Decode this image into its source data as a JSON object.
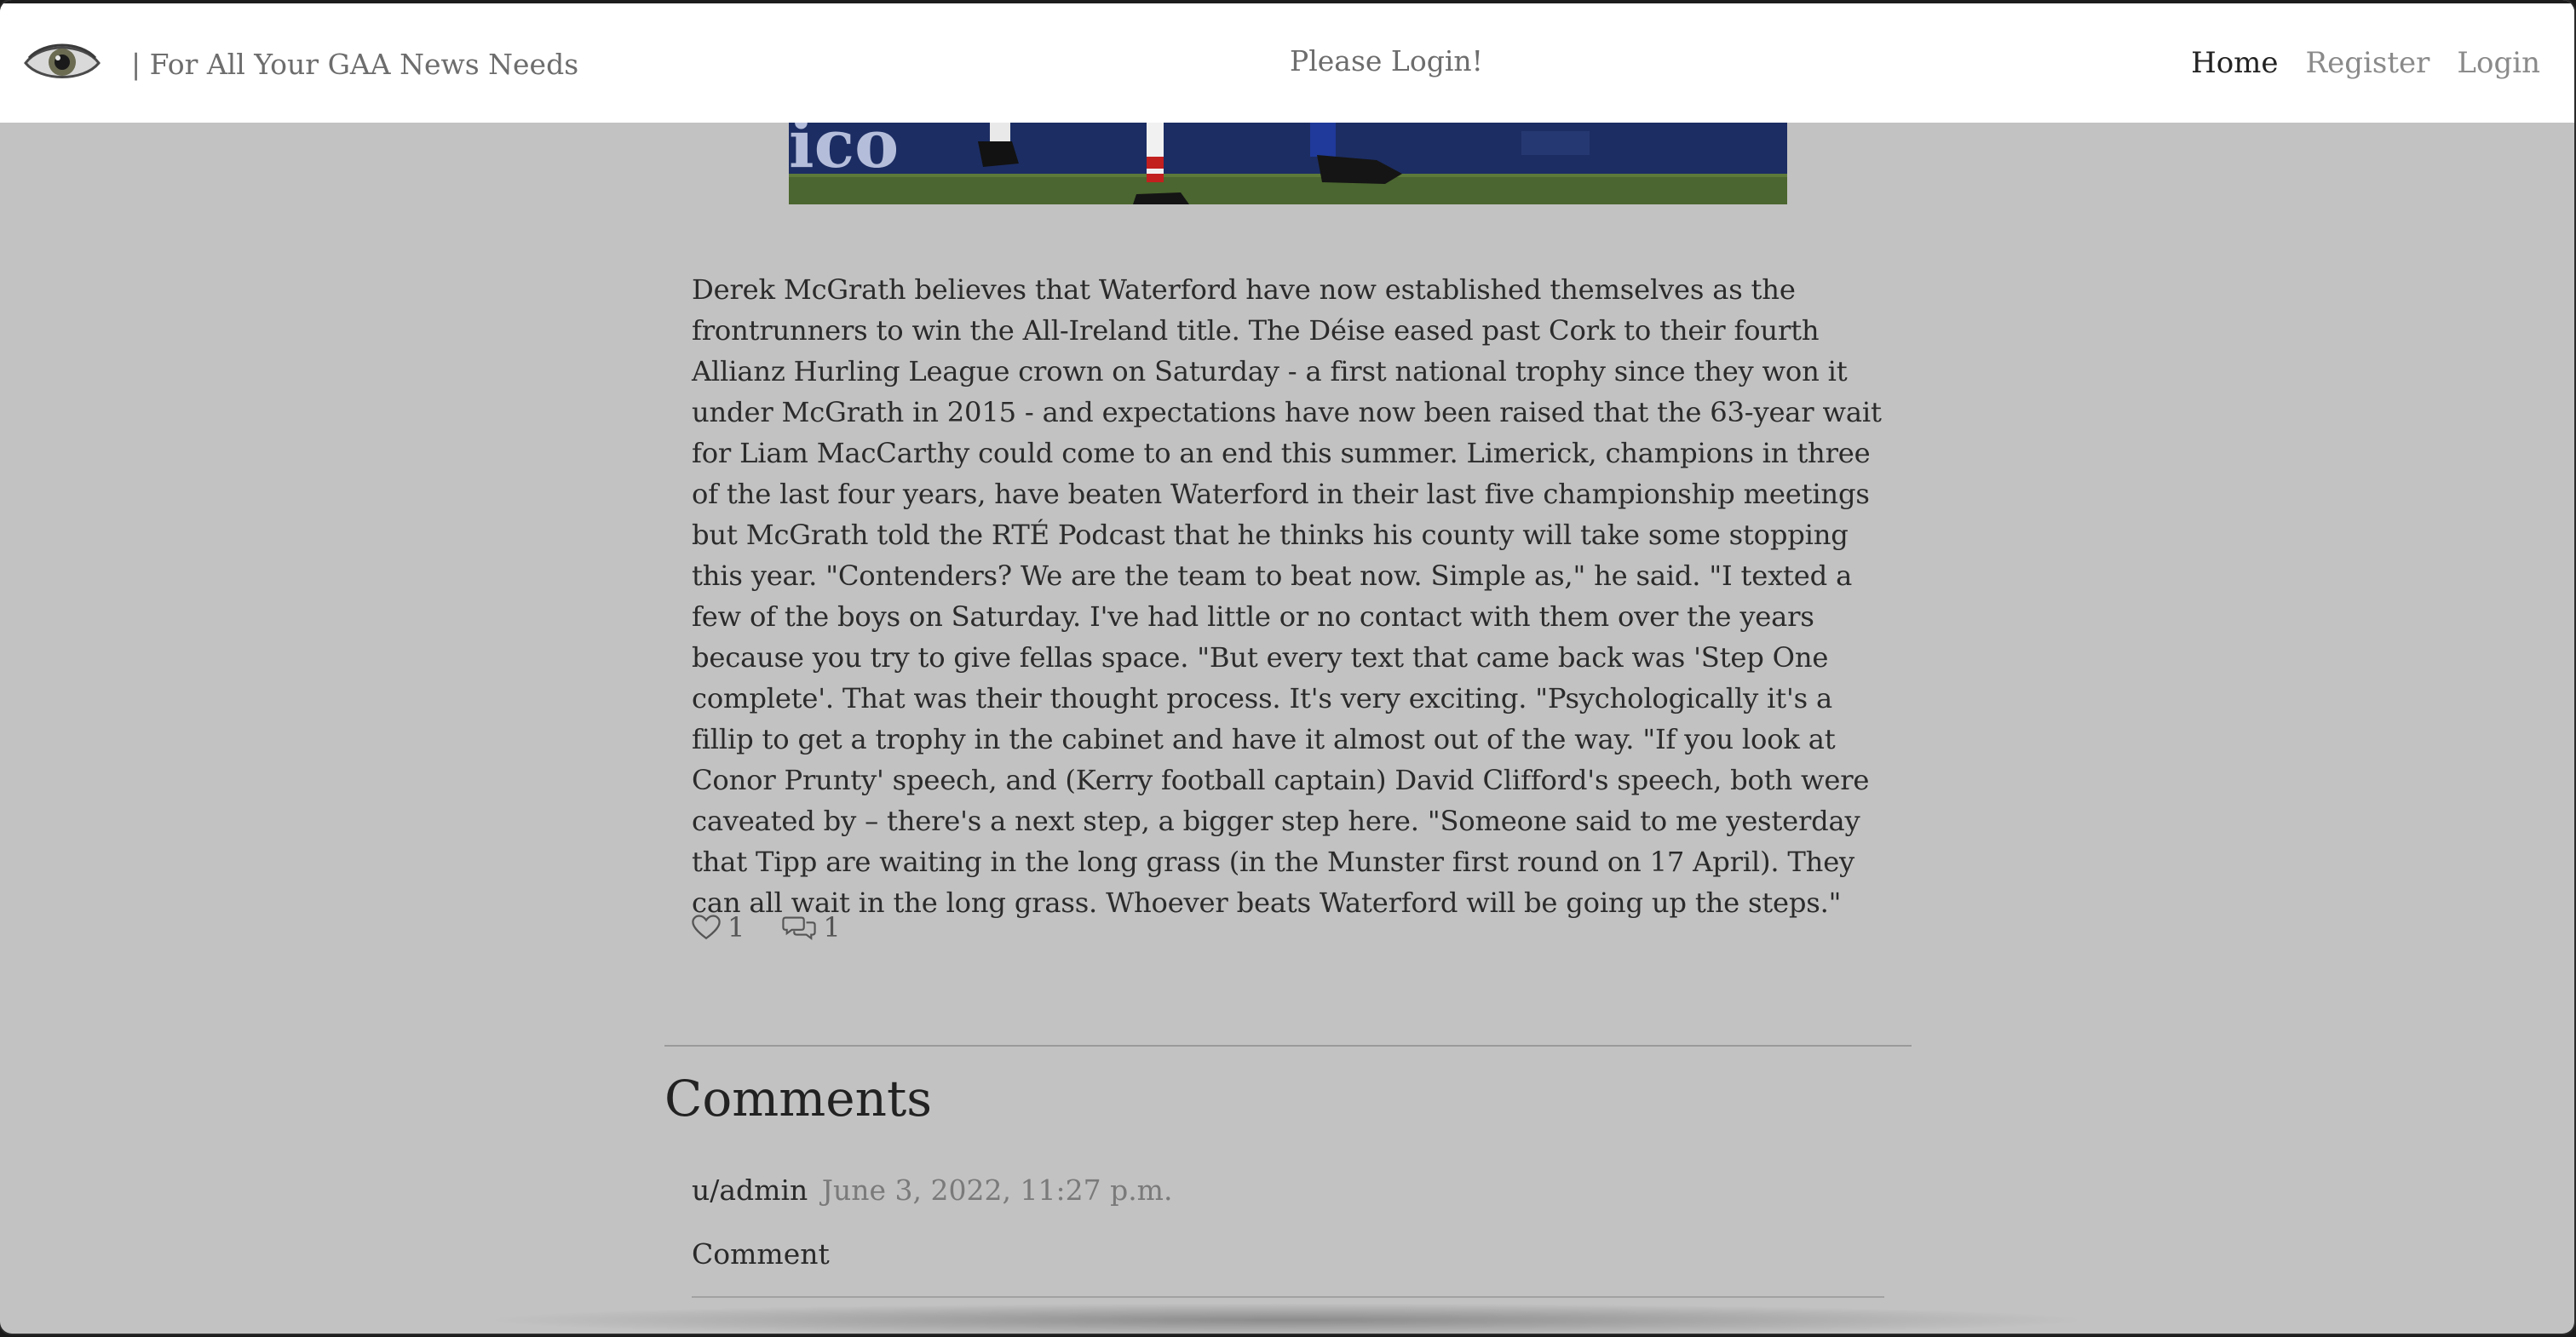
{
  "navbar": {
    "logo_icon": "eye-icon",
    "tagline": "| For All Your GAA News Needs",
    "login_notice": "Please Login!",
    "links": [
      {
        "label": "Home",
        "active": true
      },
      {
        "label": "Register",
        "active": false
      },
      {
        "label": "Login",
        "active": false
      }
    ]
  },
  "article": {
    "body": "Derek McGrath believes that Waterford have now established themselves as the frontrunners to win the All-Ireland title. The Déise eased past Cork to their fourth Allianz Hurling League crown on Saturday - a first national trophy since they won it under McGrath in 2015 - and expectations have now been raised that the 63-year wait for Liam MacCarthy could come to an end this summer. Limerick, champions in three of the last four years, have beaten Waterford in their last five championship meetings but McGrath told the RTÉ Podcast that he thinks his county will take some stopping this year. \"Contenders? We are the team to beat now. Simple as,\" he said. \"I texted a few of the boys on Saturday. I've had little or no contact with them over the years because you try to give fellas space. \"But every text that came back was 'Step One complete'. That was their thought process. It's very exciting. \"Psychologically it's a fillip to get a trophy in the cabinet and have it almost out of the way. \"If you look at Conor Prunty' speech, and (Kerry football captain) David Clifford's speech, both were caveated by – there's a next step, a bigger step here. \"Someone said to me yesterday that Tipp are waiting in the long grass (in the Munster first round on 17 April). They can all wait in the long grass. Whoever beats Waterford will be going up the steps.\"",
    "likes": "1",
    "comments_count": "1",
    "like_icon": "heart-icon",
    "comment_icon": "comment-icon"
  },
  "comments": {
    "heading": "Comments",
    "items": [
      {
        "user": "u/admin",
        "date": "June 3, 2022, 11:27 p.m.",
        "text": "Comment"
      }
    ]
  },
  "colors": {
    "page_bg": "#c2c2c2",
    "navbar_bg": "#ffffff",
    "text": "#2b2b2b",
    "muted": "#7a7a7a"
  }
}
